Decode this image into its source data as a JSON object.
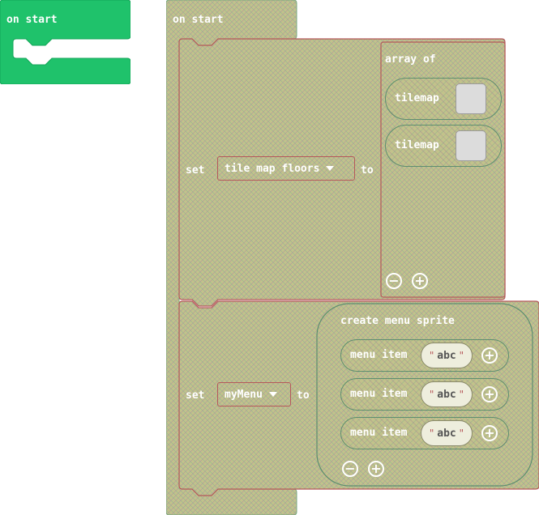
{
  "palette_block": {
    "label": "on start"
  },
  "workspace": {
    "hat_label": "on start",
    "statement1": {
      "set_label": "set",
      "variable": "tile map floors",
      "to_label": "to",
      "array_label": "array of",
      "items": [
        {
          "label": "tilemap"
        },
        {
          "label": "tilemap"
        }
      ],
      "remove_symbol": "−",
      "add_symbol": "+"
    },
    "statement2": {
      "set_label": "set",
      "variable": "myMenu",
      "to_label": "to",
      "create_label": "create menu sprite",
      "items": [
        {
          "label": "menu item",
          "value": "abc",
          "add_symbol": "+"
        },
        {
          "label": "menu item",
          "value": "abc",
          "add_symbol": "+"
        },
        {
          "label": "menu item",
          "value": "abc",
          "add_symbol": "+"
        }
      ],
      "quote_open": "\"",
      "quote_close": "\"",
      "remove_symbol": "−",
      "add_symbol": "+"
    }
  },
  "colors": {
    "palette_green": "#1fc26b",
    "block_olive": "#c2c28b",
    "block_border": "#b5585a",
    "pill_border": "#5d8e6f"
  }
}
